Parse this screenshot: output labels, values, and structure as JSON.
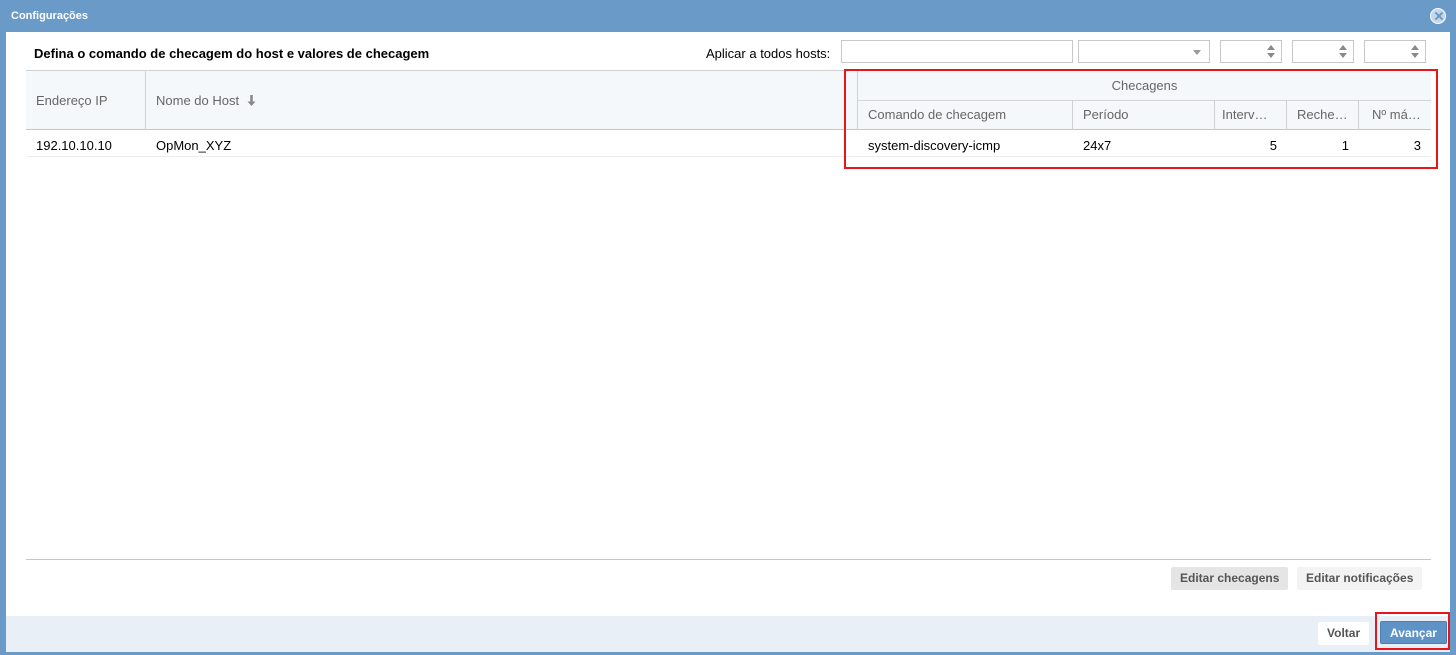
{
  "window": {
    "title": "Configurações"
  },
  "heading": "Defina o comando de checagem do host e valores de checagem",
  "apply_all": {
    "label": "Aplicar a todos hosts:"
  },
  "table": {
    "group_header": "Checagens",
    "columns": {
      "ip": "Endereço IP",
      "host": "Nome do Host",
      "command": "Comando de checagem",
      "period": "Período",
      "interval": "Interv…",
      "recheck": "Reche…",
      "max": "Nº má…"
    },
    "rows": [
      {
        "ip": "192.10.10.10",
        "host": "OpMon_XYZ",
        "command": "system-discovery-icmp",
        "period": "24x7",
        "interval": "5",
        "recheck": "1",
        "max": "3"
      }
    ]
  },
  "buttons": {
    "edit_checks": "Editar checagens",
    "edit_notifications": "Editar notificações",
    "back": "Voltar",
    "next": "Avançar"
  },
  "colors": {
    "titlebar": "#6a9ac8",
    "highlight": "#e8151b",
    "primary_button": "#5f93c6"
  }
}
